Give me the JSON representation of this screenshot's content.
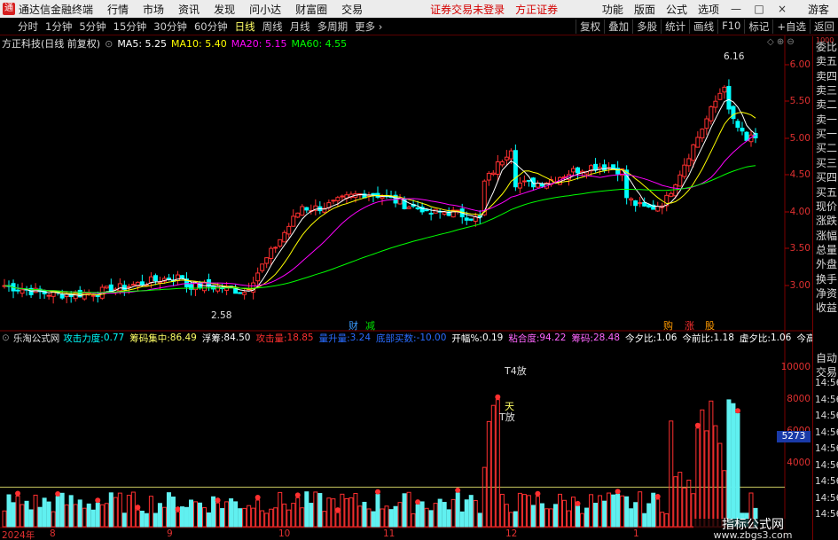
{
  "titlebar": {
    "app": "通达信金融终端",
    "menu": [
      "行情",
      "市场",
      "资讯",
      "发现",
      "问小达",
      "财富圈",
      "交易"
    ],
    "warning": "证券交易未登录",
    "broker": "方正证券",
    "right_menu": [
      "功能",
      "版面",
      "公式",
      "选项"
    ],
    "guest": "游客",
    "win_min": "—",
    "win_max": "□",
    "win_close": "×"
  },
  "toolbar": {
    "periods": [
      "分时",
      "1分钟",
      "5分钟",
      "15分钟",
      "30分钟",
      "60分钟",
      "日线",
      "周线",
      "月线",
      "多周期",
      "更多 ›"
    ],
    "active_period": "日线",
    "right_buttons": [
      "复权",
      "叠加",
      "多股",
      "统计",
      "画线",
      "F10",
      "标记",
      "+自选",
      "返回"
    ]
  },
  "chart_header": {
    "stock": "方正科技(日线 前复权)",
    "ma5": "MA5: 5.25",
    "ma10": "MA10: 5.40",
    "ma20": "MA20: 5.15",
    "ma60": "MA60: 4.55",
    "colors": {
      "ma5": "#ffffff",
      "ma10": "#ffff00",
      "ma20": "#ff00ff",
      "ma60": "#00ff00",
      "up": "#ff3030",
      "down": "#00ffff"
    }
  },
  "price_axis": [
    "6.00",
    "5.50",
    "5.00",
    "4.50",
    "4.00",
    "3.50",
    "3.00"
  ],
  "price_annotations": {
    "high": "6.16",
    "low": "2.58"
  },
  "event_tags": {
    "cai": "财",
    "jian": "减",
    "gou": "购",
    "zhang": "涨",
    "gu": "股"
  },
  "right_panel": [
    "委比",
    "卖五",
    "卖四",
    "卖三",
    "卖二",
    "卖一",
    "买一",
    "买二",
    "买三",
    "买四",
    "买五",
    "现价",
    "涨跌",
    "涨幅",
    "总量",
    "外盘",
    "换手",
    "净资",
    "收益",
    "自动",
    "交易"
  ],
  "right_panel_top": "1000",
  "right_panel_times": [
    "14:56",
    "14:56",
    "14:56",
    "14:56",
    "14:56",
    "14:56",
    "14:56",
    "14:56",
    "14:56"
  ],
  "indicator": {
    "name": "乐淘公式网",
    "items": [
      {
        "label": "攻击力度: ",
        "value": "0.77",
        "color": "#00ffff"
      },
      {
        "label": "筹码集中: ",
        "value": "86.49",
        "color": "#ffff66"
      },
      {
        "label": "浮筹: ",
        "value": "84.50",
        "color": "#ffffff"
      },
      {
        "label": "攻击量: ",
        "value": "18.85",
        "color": "#ff3030"
      },
      {
        "label": "量升量: ",
        "value": "3.24",
        "color": "#2a6cff"
      },
      {
        "label": "底部买数: ",
        "value": "-10.00",
        "color": "#2a6cff"
      },
      {
        "label": "开幅%: ",
        "value": "0.19",
        "color": "#ffffff"
      },
      {
        "label": "粘合度: ",
        "value": "94.22",
        "color": "#ff66ff"
      },
      {
        "label": "筹码: ",
        "value": "28.48",
        "color": "#ff66ff"
      },
      {
        "label": "今夕比: ",
        "value": "1.06",
        "color": "#ffffff"
      },
      {
        "label": "今前比: ",
        "value": "1.18",
        "color": "#ffffff"
      },
      {
        "label": "虚夕比: ",
        "value": "1.06",
        "color": "#ffffff"
      },
      {
        "label": "今高比: ",
        "value": "0.40",
        "color": "#ffffff"
      },
      {
        "label": "虚",
        "value": "",
        "color": "#ffffff"
      }
    ],
    "labels": {
      "t4": "T4放",
      "tian": "天",
      "tfang": "T放"
    }
  },
  "volume_axis": [
    "10000",
    "8000",
    "6000",
    "4000"
  ],
  "volume_highlight": "5273",
  "dates": [
    "2024年",
    "8",
    "9",
    "10",
    "11",
    "12",
    "1"
  ],
  "watermark": {
    "line1": "指标公式网",
    "line2": "www.zbgs3.com"
  }
}
